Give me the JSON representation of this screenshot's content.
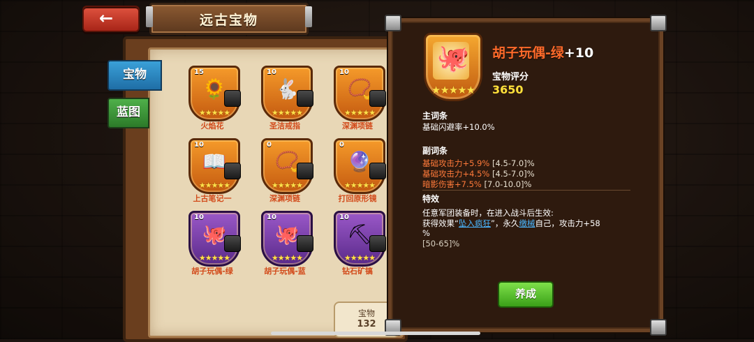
{
  "header": {
    "back_arrow": "←",
    "title": "远古宝物"
  },
  "tabs": [
    {
      "label": "宝物"
    },
    {
      "label": "蓝图"
    }
  ],
  "items": [
    {
      "level": "15",
      "glyph": "🌻",
      "stars": "★★★★★",
      "name": "火焰花",
      "frame": "orange"
    },
    {
      "level": "10",
      "glyph": "🐇",
      "stars": "★★★★★",
      "name": "圣洁戒指",
      "frame": "orange"
    },
    {
      "level": "10",
      "glyph": "📿",
      "stars": "★★★★★",
      "name": "深渊项链",
      "frame": "orange"
    },
    {
      "level": "10",
      "glyph": "📖",
      "stars": "★★★★★",
      "name": "上古笔记一",
      "frame": "orange"
    },
    {
      "level": "0",
      "glyph": "📿",
      "stars": "★★★★★",
      "name": "深渊项链",
      "frame": "orange"
    },
    {
      "level": "0",
      "glyph": "🔮",
      "stars": "★★★★★",
      "name": "打回原形镜",
      "frame": "orange"
    },
    {
      "level": "10",
      "glyph": "🐙",
      "stars": "★★★★★",
      "name": "胡子玩偶-绿",
      "frame": "purple"
    },
    {
      "level": "10",
      "glyph": "🐙",
      "stars": "★★★★★",
      "name": "胡子玩偶-蓝",
      "frame": "purple"
    },
    {
      "level": "10",
      "glyph": "⛏",
      "stars": "★★★★★",
      "name": "钻石矿镐",
      "frame": "purple"
    }
  ],
  "count_plate": {
    "label": "宝物",
    "value": "132"
  },
  "detail": {
    "badge_glyph": "🐙",
    "badge_stars": "★★★★★",
    "title": "胡子玩偶-绿",
    "title_plus": "+10",
    "rating_label": "宝物评分",
    "rating_value": "3650",
    "main_attr_header": "主词条",
    "main_attr": "基础闪避率+10.0%",
    "sub_attr_header": "副词条",
    "sub_attrs": [
      {
        "text": "基础攻击力+5.9%",
        "range": "[4.5-7.0]%"
      },
      {
        "text": "基础攻击力+4.5%",
        "range": "[4.5-7.0]%"
      },
      {
        "text": "暗影伤害+7.5%",
        "range": "[7.0-10.0]%"
      }
    ],
    "effect_header": "特效",
    "effect_line1": "任意军团装备时，在进入战斗后生效:",
    "effect_line2_a": "获得效果“",
    "effect_link1": "坠入疯狂",
    "effect_line2_b": "”，永久",
    "effect_link2": "缴械",
    "effect_line2_c": "自己，攻击力+58",
    "effect_line3": "%",
    "effect_line4": "[50-65]%",
    "cultivate_label": "养成"
  },
  "colors": {
    "accent_orange": "#ff6a2a",
    "rating_yellow": "#ffe03a",
    "link_blue": "#4ab6ff",
    "button_green": "#5cc82a"
  }
}
